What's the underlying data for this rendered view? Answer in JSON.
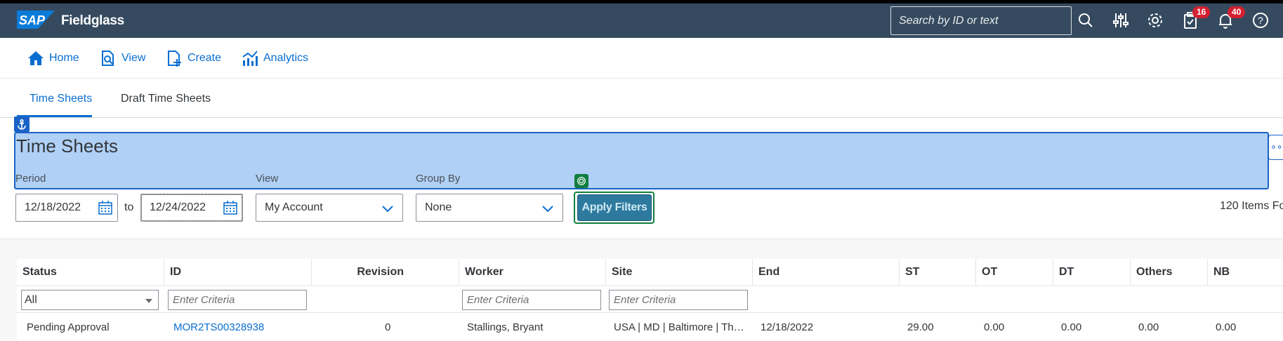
{
  "shell": {
    "brand": "Fieldglass",
    "logo_text": "SAP",
    "search_placeholder": "Search by ID or text",
    "icons": [
      "search-icon",
      "filter-sliders-icon",
      "gear-icon",
      "clipboard-icon",
      "bell-icon",
      "help-icon"
    ],
    "task_badge": "16",
    "notification_badge": "40"
  },
  "nav": {
    "home": "Home",
    "view": "View",
    "create": "Create",
    "analytics": "Analytics"
  },
  "tabs": {
    "time_sheets": "Time Sheets",
    "draft_time_sheets": "Draft Time Sheets"
  },
  "page": {
    "title": "Time Sheets",
    "period_label": "Period",
    "view_label": "View",
    "group_by_label": "Group By",
    "period_start": "12/18/2022",
    "to_label": "to",
    "period_end": "12/24/2022",
    "view_value": "My Account",
    "group_by_value": "None",
    "apply_label": "Apply Filters",
    "items_found": "120 Items Fo"
  },
  "table": {
    "headers": [
      "Status",
      "ID",
      "Revision",
      "Worker",
      "Site",
      "End",
      "ST",
      "OT",
      "DT",
      "Others",
      "NB"
    ],
    "status_filter": "All",
    "criteria_placeholder": "Enter Criteria",
    "rows": [
      {
        "status": "Pending Approval",
        "id": "MOR2TS00328938",
        "revision": "0",
        "worker": "Stallings, Bryant",
        "site": "USA | MD | Baltimore | Th…",
        "end": "12/18/2022",
        "st": "29.00",
        "ot": "0.00",
        "dt": "0.00",
        "others": "0.00",
        "nb": "0.00"
      }
    ]
  },
  "colors": {
    "shell": "#354a5f",
    "link": "#0a6ed1",
    "highlight": "#b0d0f5",
    "apply": "#2e7a9f"
  }
}
